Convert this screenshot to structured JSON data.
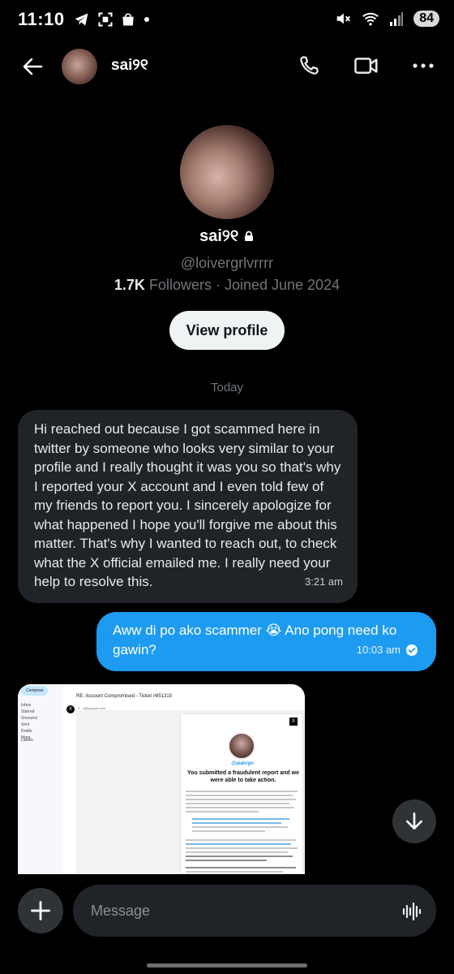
{
  "status_bar": {
    "time": "11:10",
    "battery": "84",
    "left_icons": [
      "telegram-icon",
      "screenshot-icon",
      "shopping-bag-icon",
      "dot-icon"
    ],
    "right_icons": [
      "mute-icon",
      "wifi-icon",
      "signal-icon"
    ]
  },
  "header": {
    "name": "sai୨୧",
    "icons": [
      "back-arrow-icon",
      "phone-icon",
      "video-icon",
      "more-icon"
    ]
  },
  "profile": {
    "name": "sai୨୧",
    "handle": "@loivergrlvrrrr",
    "followers_count": "1.7K",
    "followers_label": "Followers · Joined June 2024",
    "view_profile_label": "View profile"
  },
  "conversation": {
    "day_label": "Today",
    "messages": [
      {
        "direction": "incoming",
        "text": "Hi reached out because I got scammed here in twitter by someone who looks very similar to your profile and I really thought it was you so that's why I reported your X account and I even told few of my friends to report you. I sincerely apologize for what happened I hope you'll forgive me about this matter. That's why I wanted to reach out, to check what the X official emailed me. I really need your help to resolve this.",
        "time": "3:21 am"
      },
      {
        "direction": "outgoing",
        "text": "Aww di po ako scammer 😭 Ano pong need ko gawin?",
        "time": "10:03 am",
        "status_icon": "check-circle-icon"
      }
    ],
    "attachment": {
      "compose": "Compose",
      "nav": [
        "Inbox",
        "Starred",
        "Snoozed",
        "Sent",
        "Drafts",
        "More"
      ],
      "labels": "Labels",
      "subject": "RE: Account Compromised - Ticket #851315",
      "sender": "X · x@support.com",
      "card_handle": "@aiahrgn",
      "card_title": "You submitted a fraudulent report and we were able to take action."
    }
  },
  "composer": {
    "placeholder": "Message",
    "icons": [
      "plus-icon",
      "voice-wave-icon"
    ]
  },
  "colors": {
    "accent": "#1d9bf0",
    "incoming_bubble": "#202327",
    "background": "#000000"
  }
}
